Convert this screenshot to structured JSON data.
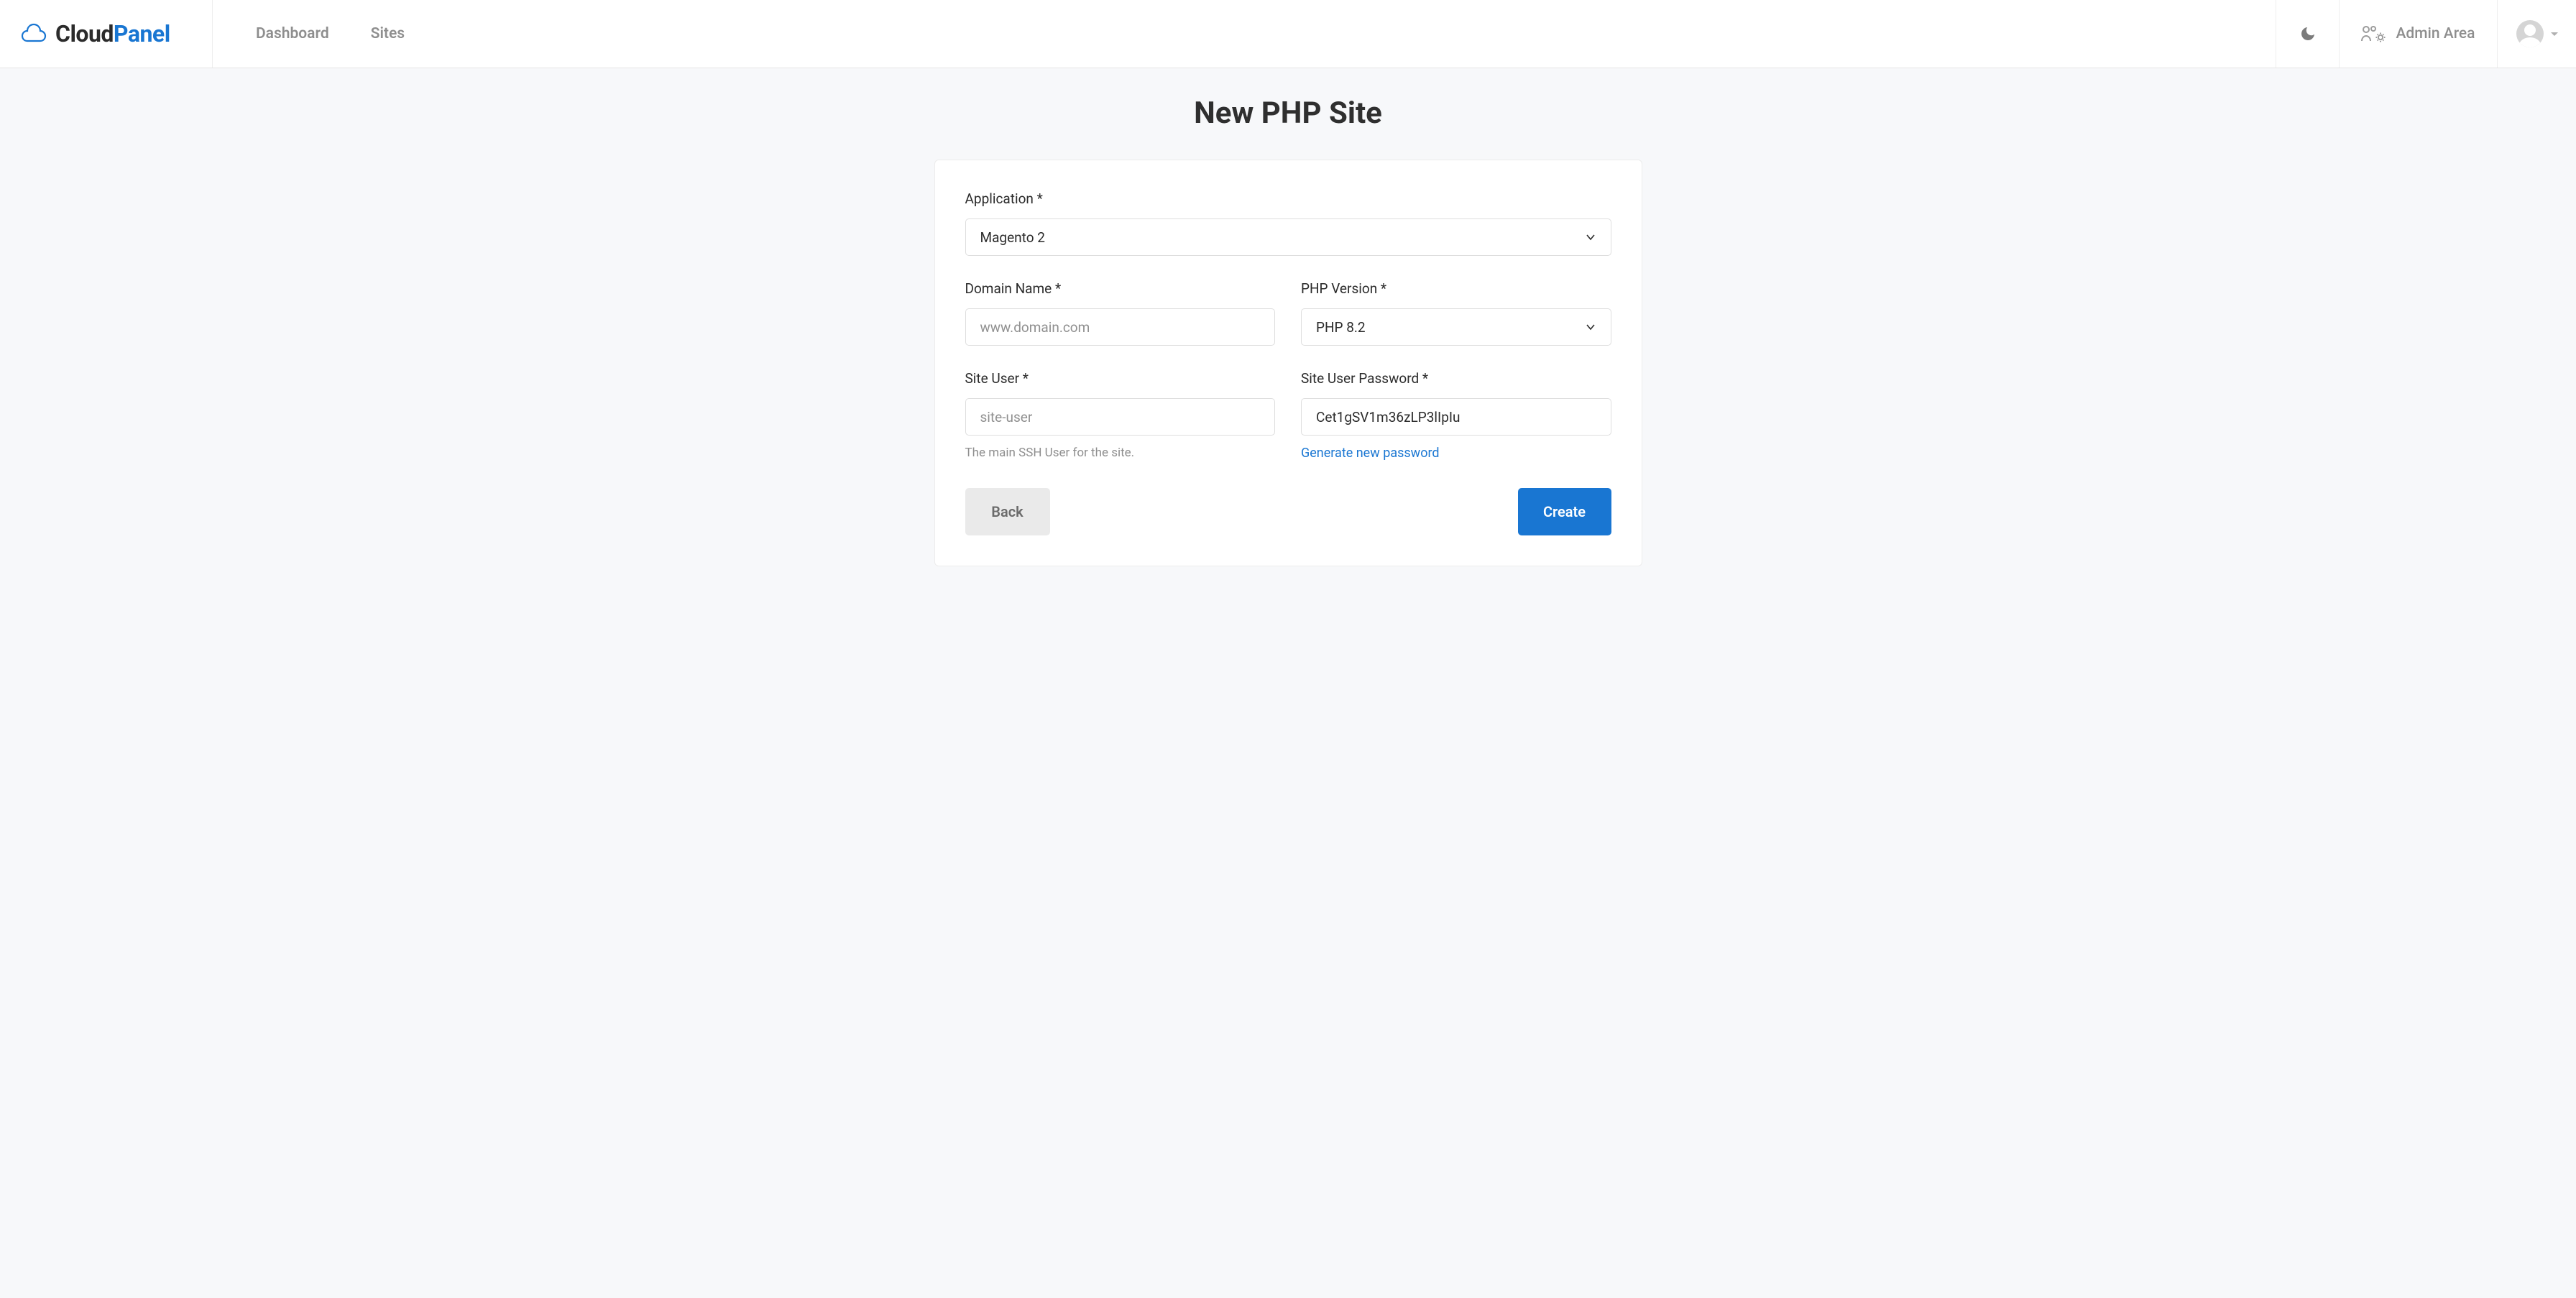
{
  "header": {
    "logo_cloud": "Cloud",
    "logo_panel": "Panel",
    "nav": {
      "dashboard": "Dashboard",
      "sites": "Sites"
    },
    "admin_area": "Admin Area"
  },
  "page": {
    "title": "New PHP Site"
  },
  "form": {
    "application": {
      "label": "Application *",
      "value": "Magento 2"
    },
    "domain": {
      "label": "Domain Name *",
      "placeholder": "www.domain.com",
      "value": ""
    },
    "php_version": {
      "label": "PHP Version *",
      "value": "PHP 8.2"
    },
    "site_user": {
      "label": "Site User *",
      "placeholder": "site-user",
      "value": "",
      "help": "The main SSH User for the site."
    },
    "site_user_password": {
      "label": "Site User Password *",
      "value": "Cet1gSV1m36zLP3lIpIu",
      "generate_link": "Generate new password"
    }
  },
  "actions": {
    "back": "Back",
    "create": "Create"
  }
}
